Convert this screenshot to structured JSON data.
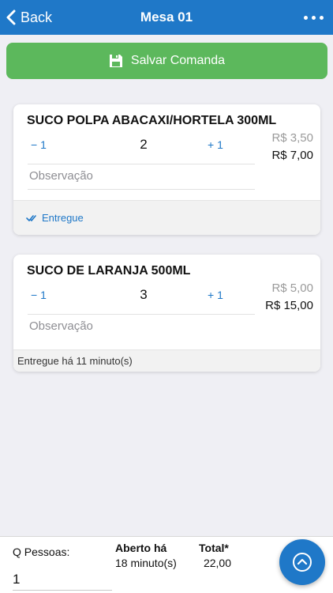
{
  "header": {
    "back_label": "Back",
    "title": "Mesa 01",
    "more_icon": "more-dots-icon"
  },
  "save_button": {
    "label": "Salvar Comanda",
    "icon": "floppy-disk-icon"
  },
  "items": [
    {
      "name": "SUCO POLPA ABACAXI/HORTELA 300ML",
      "decrement_label": "− 1",
      "quantity": "2",
      "increment_label": "+ 1",
      "unit_price": "R$ 3,50",
      "total_price": "R$ 7,00",
      "observation_placeholder": "Observação",
      "status": "Entregue"
    },
    {
      "name": "SUCO DE LARANJA 500ML",
      "decrement_label": "− 1",
      "quantity": "3",
      "increment_label": "+ 1",
      "unit_price": "R$ 5,00",
      "total_price": "R$ 15,00",
      "observation_placeholder": "Observação",
      "status": "Entregue há 11 minuto(s)"
    }
  ],
  "footer": {
    "people_label": "Q Pessoas:",
    "people_value": "1",
    "opened_label": "Aberto há",
    "opened_value": "18 minuto(s)",
    "total_label": "Total*",
    "total_value": "22,00"
  },
  "fab": {
    "icon": "chevron-up-circle-icon"
  },
  "colors": {
    "header": "#1f78c8",
    "save_button": "#5cb85c",
    "accent": "#1f78c8",
    "background": "#efeff4"
  }
}
